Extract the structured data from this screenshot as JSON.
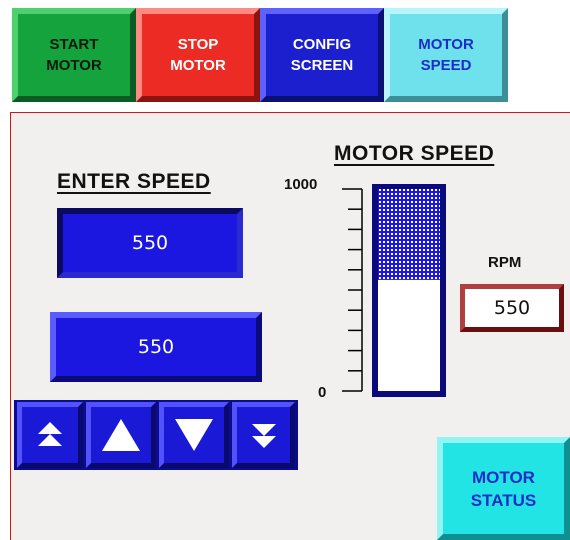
{
  "top_buttons": {
    "start": "START\nMOTOR",
    "stop": "STOP\nMOTOR",
    "config": "CONFIG\nSCREEN",
    "speed": "MOTOR\nSPEED"
  },
  "enter_speed": {
    "heading": "ENTER SPEED",
    "display_value": "550",
    "input_value": "550",
    "arrows": [
      {
        "name": "fast-increase-icon"
      },
      {
        "name": "increase-icon"
      },
      {
        "name": "decrease-icon"
      },
      {
        "name": "fast-decrease-icon"
      }
    ]
  },
  "motor_speed": {
    "heading": "MOTOR SPEED",
    "scale_max": "1000",
    "scale_min": "0",
    "max_value": 1000,
    "current_value": 550,
    "fill_color": "#1c17e0",
    "rpm_label": "RPM",
    "rpm_value": "550"
  },
  "motor_status": {
    "label": "MOTOR\nSTATUS"
  },
  "colors": {
    "green": "#14a33c",
    "red": "#ec2b25",
    "blue": "#1b1fce",
    "cyan": "#6fe1ec",
    "status": "#23e4e4"
  }
}
